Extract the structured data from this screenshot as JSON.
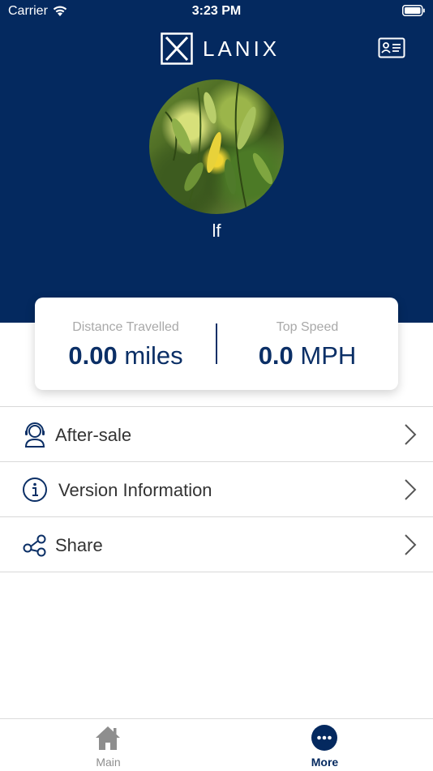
{
  "status_bar": {
    "carrier": "Carrier",
    "time": "3:23 PM"
  },
  "header": {
    "logo_text": "LANIX",
    "background": "#04295f"
  },
  "profile": {
    "username": "lf"
  },
  "stats": {
    "distance": {
      "label": "Distance Travelled",
      "value": "0.00",
      "unit": "miles"
    },
    "speed": {
      "label": "Top Speed",
      "value": "0.0",
      "unit": "MPH"
    }
  },
  "menu": {
    "items": [
      {
        "label": "After-sale",
        "icon": "headset-user-icon"
      },
      {
        "label": "Version Information",
        "icon": "info-icon"
      },
      {
        "label": "Share",
        "icon": "share-icon"
      }
    ]
  },
  "tabbar": {
    "tabs": [
      {
        "label": "Main",
        "icon": "home-icon"
      },
      {
        "label": "More",
        "icon": "more-icon"
      }
    ]
  },
  "colors": {
    "accent": "#04295f",
    "divider": "#d9d9d9",
    "muted": "#a9a9a9"
  }
}
